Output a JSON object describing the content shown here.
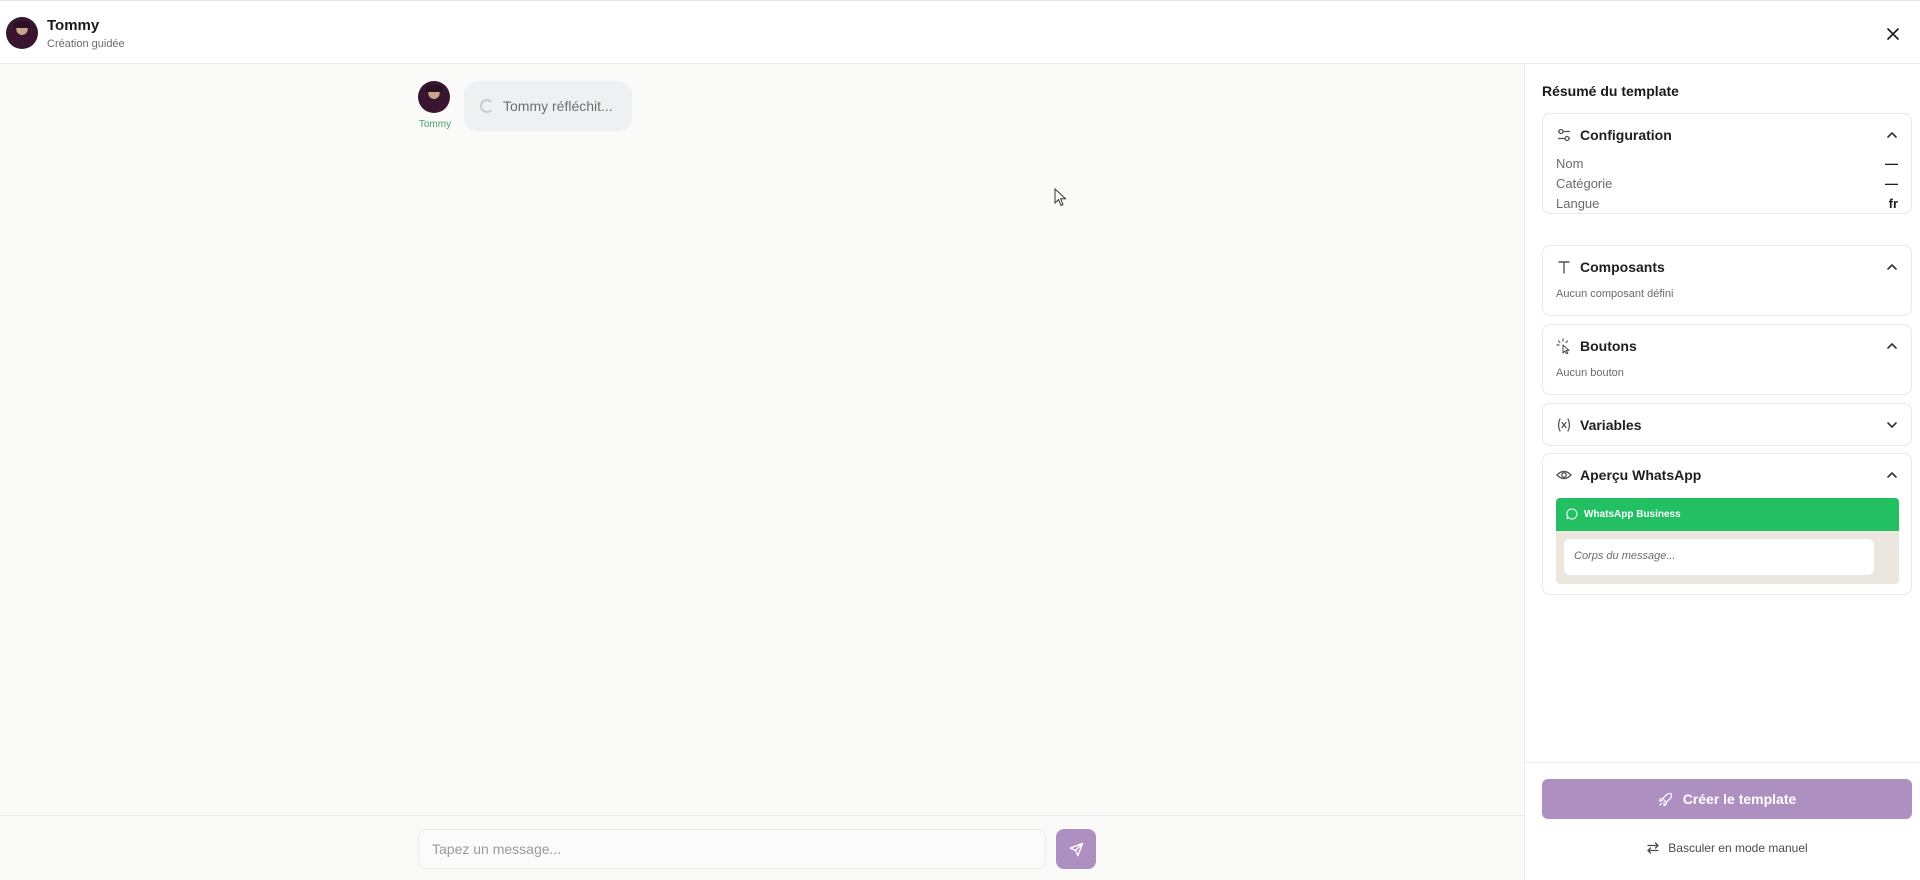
{
  "header": {
    "name": "Tommy",
    "subtitle": "Création guidée"
  },
  "chat": {
    "messages": [
      {
        "author": "Tommy",
        "text": "Tommy réfléchit..."
      }
    ],
    "input_placeholder": "Tapez un message..."
  },
  "panel": {
    "title": "Résumé du template",
    "configuration": {
      "title": "Configuration",
      "expanded": true,
      "rows": [
        {
          "label": "Nom",
          "value": "—"
        },
        {
          "label": "Catégorie",
          "value": "—"
        },
        {
          "label": "Langue",
          "value": "fr"
        }
      ]
    },
    "composants": {
      "title": "Composants",
      "expanded": true,
      "empty": "Aucun composant défini"
    },
    "boutons": {
      "title": "Boutons",
      "expanded": true,
      "empty": "Aucun bouton"
    },
    "variables": {
      "title": "Variables",
      "expanded": false
    },
    "apercu": {
      "title": "Aperçu WhatsApp",
      "expanded": true,
      "bar_label": "WhatsApp Business",
      "message_placeholder": "Corps du message..."
    },
    "create_button": "Créer le template",
    "switch_link": "Basculer en mode manuel"
  },
  "colors": {
    "accent": "#ad8fc2",
    "whatsapp_green": "#22c063",
    "author_green": "#4aa06a"
  },
  "icons": [
    "close-icon",
    "spinner-icon",
    "send-icon",
    "sliders-icon",
    "text-icon",
    "pointer-click-icon",
    "variable-icon",
    "eye-icon",
    "chevron-up-icon",
    "chevron-down-icon",
    "whatsapp-icon",
    "rocket-icon",
    "swap-icon",
    "mouse-cursor-icon"
  ]
}
